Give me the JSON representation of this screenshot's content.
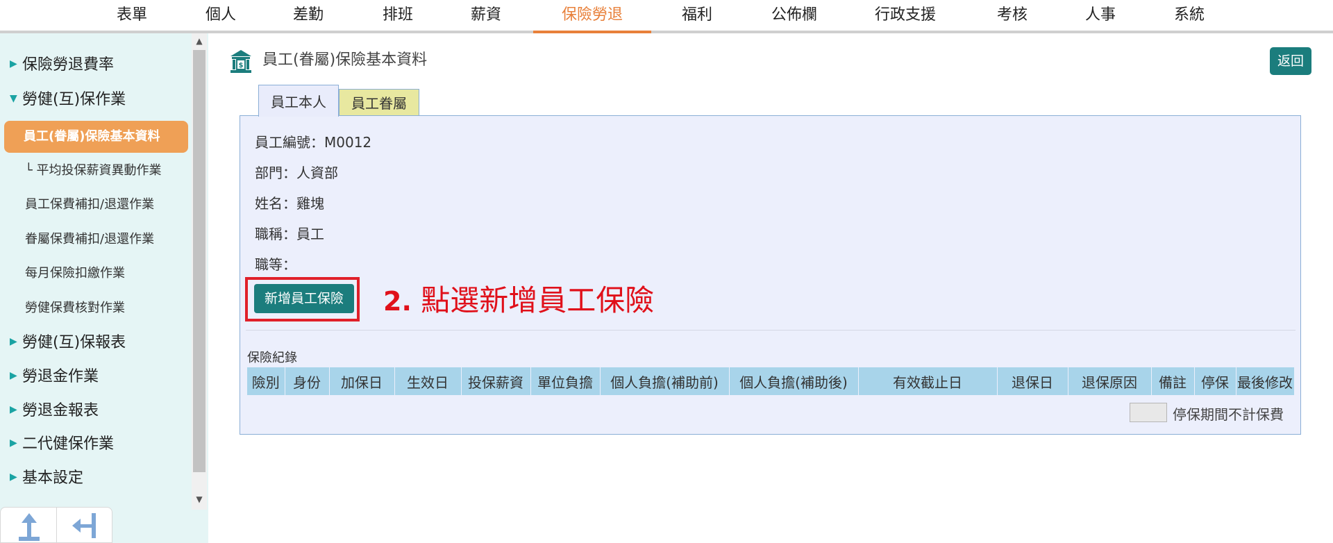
{
  "topnav": {
    "items": [
      "表單",
      "個人",
      "差勤",
      "排班",
      "薪資",
      "保險勞退",
      "福利",
      "公佈欄",
      "行政支援",
      "考核",
      "人事",
      "系統"
    ],
    "active_index": 5,
    "accent": "#e8803a"
  },
  "sidebar": {
    "items": [
      {
        "label": "保險勞退費率",
        "level": 1,
        "expanded": false
      },
      {
        "label": "勞健(互)保作業",
        "level": 1,
        "expanded": true
      },
      {
        "label": "員工(眷屬)保險基本資料",
        "level": 2,
        "active": true
      },
      {
        "label": "└ 平均投保薪資異動作業",
        "level": 2
      },
      {
        "label": "員工保費補扣/退還作業",
        "level": 2
      },
      {
        "label": "眷屬保費補扣/退還作業",
        "level": 2
      },
      {
        "label": "每月保險扣繳作業",
        "level": 2
      },
      {
        "label": "勞健保費核對作業",
        "level": 2
      },
      {
        "label": "勞健(互)保報表",
        "level": 1,
        "expanded": false
      },
      {
        "label": "勞退金作業",
        "level": 1,
        "expanded": false
      },
      {
        "label": "勞退金報表",
        "level": 1,
        "expanded": false
      },
      {
        "label": "二代健保作業",
        "level": 1,
        "expanded": false
      },
      {
        "label": "基本設定",
        "level": 1,
        "expanded": false
      }
    ],
    "bottom_buttons": [
      "scroll-top-icon",
      "collapse-sidebar-icon"
    ]
  },
  "page": {
    "title": "員工(眷屬)保險基本資料",
    "back_label": "返回"
  },
  "tabs": [
    "員工本人",
    "員工眷屬"
  ],
  "employee": {
    "id_label": "員工編號：",
    "id": "M0012",
    "dept_label": "部門：",
    "dept": "人資部",
    "name_label": "姓名：",
    "name": "雞塊",
    "title_label": "職稱：",
    "title": "員工",
    "grade_label": "職等：",
    "grade": ""
  },
  "add_button_label": "新增員工保險",
  "annotation": {
    "number": "2.",
    "text": "點選新增員工保險",
    "color": "#e0101a"
  },
  "records": {
    "label": "保險紀錄",
    "columns": [
      "險別",
      "身份",
      "加保日",
      "生效日",
      "投保薪資",
      "單位負擔",
      "個人負擔(補助前)",
      "個人負擔(補助後)",
      "有效截止日",
      "退保日",
      "退保原因",
      "備註",
      "停保",
      "最後修改"
    ],
    "rows": []
  },
  "legend": {
    "text": "停保期間不計保費"
  },
  "colors": {
    "primary_button": "#1b7d7d",
    "sidebar_bg": "#e5f5f5",
    "sidebar_active": "#efa056",
    "panel_bg": "#eceffc",
    "table_header": "#a8d4ea"
  }
}
